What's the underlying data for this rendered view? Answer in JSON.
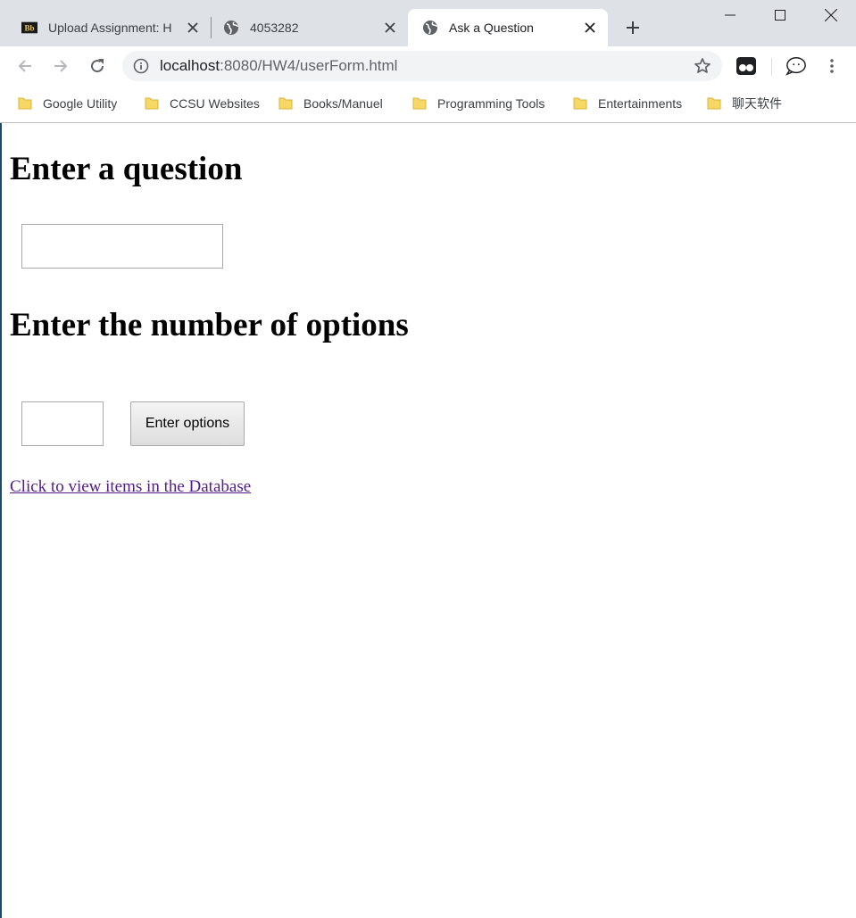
{
  "browser": {
    "tabs": [
      {
        "title": "Upload Assignment: H",
        "icon": "blackboard-icon",
        "active": false
      },
      {
        "title": "4053282",
        "icon": "globe-icon",
        "active": false
      },
      {
        "title": "Ask a Question",
        "icon": "globe-icon",
        "active": true
      }
    ],
    "address": {
      "host": "localhost",
      "rest": ":8080/HW4/userForm.html"
    },
    "bookmarks": [
      "Google Utility",
      "CCSU Websites",
      "Books/Manuel",
      "Programming Tools",
      "Entertainments",
      "聊天软件"
    ]
  },
  "page": {
    "question_heading": "Enter a question",
    "question_value": "",
    "options_heading": "Enter the number of options",
    "options_value": "",
    "enter_options_button": "Enter options",
    "db_link": "Click to view items in the Database"
  },
  "colors": {
    "visited_link": "#551a8b",
    "chrome_bg": "#dee1e6"
  }
}
